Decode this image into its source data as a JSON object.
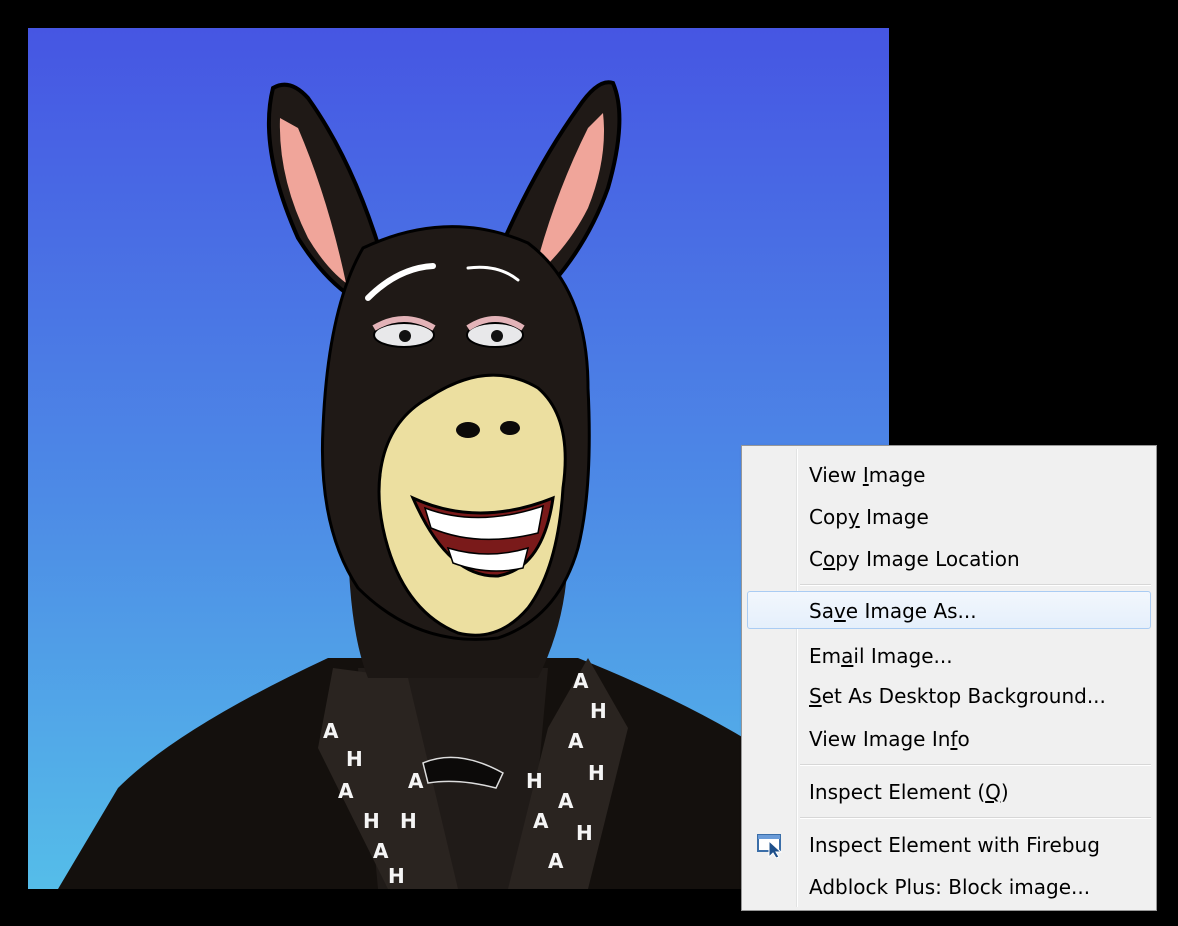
{
  "colors": {
    "sky_top": "#4656e3",
    "sky_bottom": "#55bde9",
    "menu_background": "#f0f0f0",
    "menu_border": "#979797",
    "hover_border": "#aaccf3"
  },
  "artwork": {
    "jacket_lettering": [
      "A",
      "H",
      "A",
      "H",
      "A",
      "H",
      "A",
      "H",
      "A",
      "H",
      "A",
      "H",
      "A",
      "H",
      "A",
      "H",
      "A"
    ]
  },
  "context_menu": {
    "items": [
      {
        "pre": "View ",
        "key": "I",
        "post": "mage"
      },
      {
        "pre": "Cop",
        "key": "y",
        "post": " Image"
      },
      {
        "pre": "C",
        "key": "o",
        "post": "py Image Location"
      },
      {
        "pre": "Sa",
        "key": "v",
        "post": "e Image As..."
      },
      {
        "pre": "Em",
        "key": "a",
        "post": "il Image..."
      },
      {
        "pre": "",
        "key": "S",
        "post": "et As Desktop Background..."
      },
      {
        "pre": "View Image In",
        "key": "f",
        "post": "o"
      },
      {
        "pre": "Inspect Element (",
        "key": "Q",
        "post": ")"
      },
      {
        "pre": "Inspect Element with Firebug",
        "key": "",
        "post": ""
      },
      {
        "pre": "Adblock Plus: Block image...",
        "key": "",
        "post": ""
      }
    ],
    "hovered_item": "Save Image As...",
    "firebug_icon": "firebug-inspect-icon"
  }
}
